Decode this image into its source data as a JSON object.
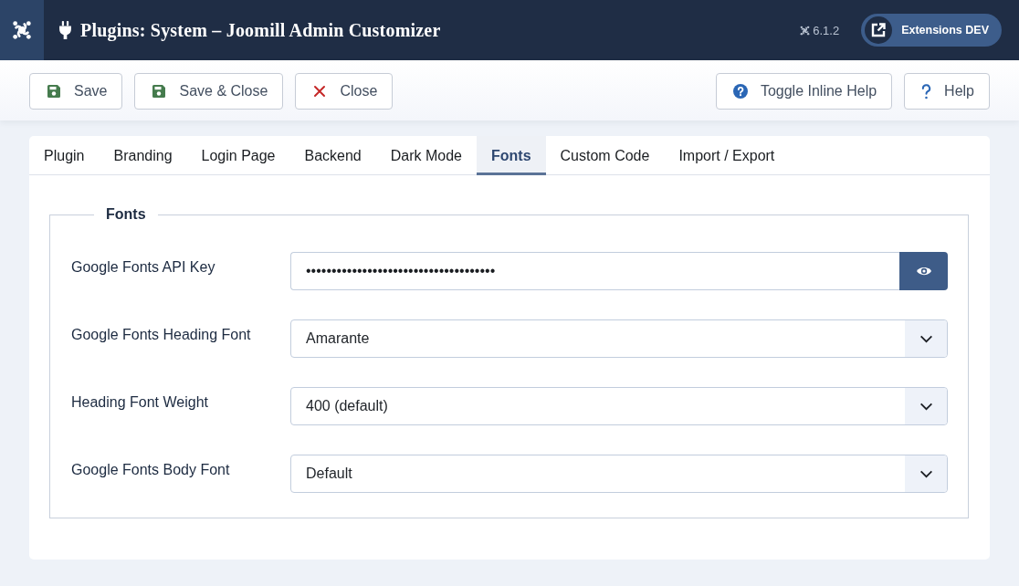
{
  "header": {
    "title": "Plugins: System – Joomill Admin Customizer",
    "version": "6.1.2",
    "site_button": "Extensions DEV"
  },
  "toolbar": {
    "buttons": [
      {
        "label": "Save",
        "kind": "save"
      },
      {
        "label": "Save & Close",
        "kind": "save"
      },
      {
        "label": "Close",
        "kind": "close"
      }
    ],
    "help_buttons": [
      {
        "label": "Toggle Inline Help",
        "kind": "info"
      },
      {
        "label": "Help",
        "kind": "question"
      }
    ]
  },
  "tabs": [
    {
      "label": "Plugin",
      "selected": false
    },
    {
      "label": "Branding",
      "selected": false
    },
    {
      "label": "Login Page",
      "selected": false
    },
    {
      "label": "Backend",
      "selected": false
    },
    {
      "label": "Dark Mode",
      "selected": false
    },
    {
      "label": "Fonts",
      "selected": true
    },
    {
      "label": "Custom Code",
      "selected": false
    },
    {
      "label": "Import / Export",
      "selected": false
    }
  ],
  "fieldset": {
    "legend": "Fonts",
    "fields": [
      {
        "label": "Google Fonts API Key",
        "kind": "password",
        "value": "•••••••••••••••••••••••••••••••••••••"
      },
      {
        "label": "Google Fonts Heading Font",
        "kind": "select",
        "value": "Amarante"
      },
      {
        "label": "Heading Font Weight",
        "kind": "select",
        "value": "400 (default)"
      },
      {
        "label": "Google Fonts Body Font",
        "kind": "select",
        "value": "Default"
      }
    ]
  }
}
